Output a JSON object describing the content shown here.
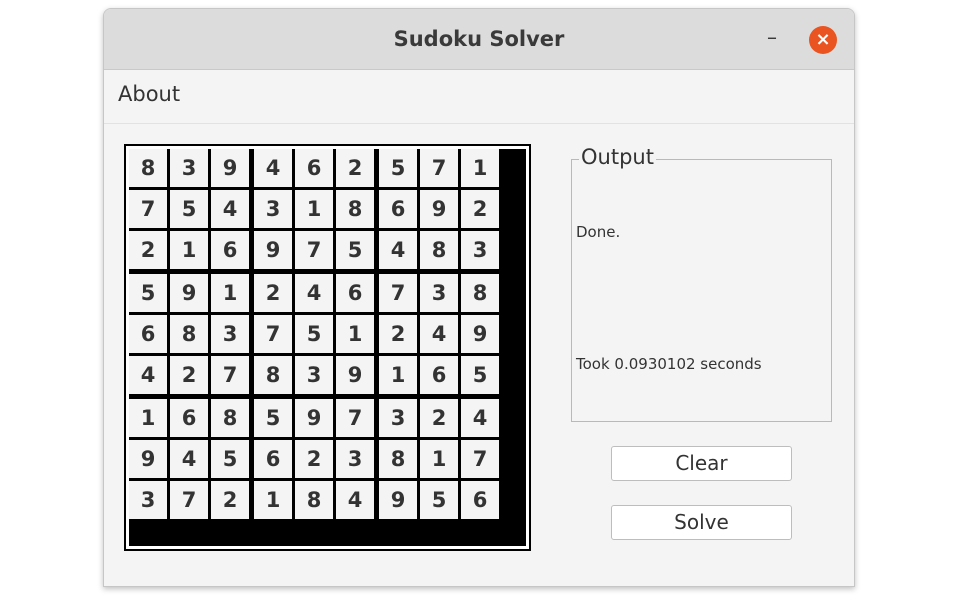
{
  "window": {
    "title": "Sudoku Solver"
  },
  "titlebar": {
    "minimize_label": "–",
    "close_label": "×"
  },
  "menu": {
    "items": [
      "About"
    ]
  },
  "sudoku": {
    "rows": [
      [
        "8",
        "3",
        "9",
        "4",
        "6",
        "2",
        "5",
        "7",
        "1"
      ],
      [
        "7",
        "5",
        "4",
        "3",
        "1",
        "8",
        "6",
        "9",
        "2"
      ],
      [
        "2",
        "1",
        "6",
        "9",
        "7",
        "5",
        "4",
        "8",
        "3"
      ],
      [
        "5",
        "9",
        "1",
        "2",
        "4",
        "6",
        "7",
        "3",
        "8"
      ],
      [
        "6",
        "8",
        "3",
        "7",
        "5",
        "1",
        "2",
        "4",
        "9"
      ],
      [
        "4",
        "2",
        "7",
        "8",
        "3",
        "9",
        "1",
        "6",
        "5"
      ],
      [
        "1",
        "6",
        "8",
        "5",
        "9",
        "7",
        "3",
        "2",
        "4"
      ],
      [
        "9",
        "4",
        "5",
        "6",
        "2",
        "3",
        "8",
        "1",
        "7"
      ],
      [
        "3",
        "7",
        "2",
        "1",
        "8",
        "4",
        "9",
        "5",
        "6"
      ]
    ]
  },
  "output": {
    "label": "Output",
    "lines": [
      "Done.",
      "",
      "Took 0.0930102 seconds"
    ]
  },
  "buttons": {
    "clear_label": "Clear",
    "solve_label": "Solve"
  },
  "colors": {
    "close_button": "#e95420",
    "window_bg": "#f4f4f4",
    "titlebar_bg": "#dcdcdc"
  }
}
